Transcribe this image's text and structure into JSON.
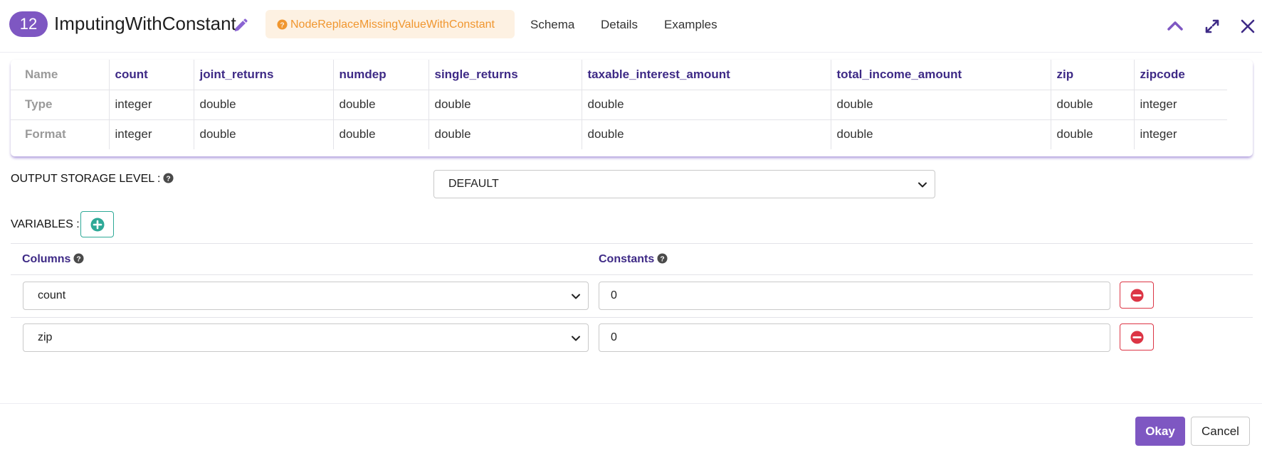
{
  "header": {
    "node_number": "12",
    "node_title": "ImputingWithConstant",
    "node_type": "NodeReplaceMissingValueWithConstant",
    "tabs": [
      "Schema",
      "Details",
      "Examples"
    ],
    "icons": [
      "pencil-icon",
      "question-circle-icon",
      "chevron-up-icon",
      "expand-icon",
      "close-icon"
    ],
    "accent_color": "#7e57c2",
    "chip_color": "#f0962f"
  },
  "schema": {
    "row_labels": [
      "Name",
      "Type",
      "Format"
    ],
    "columns": [
      {
        "name": "count",
        "type": "integer",
        "format": "integer"
      },
      {
        "name": "joint_returns",
        "type": "double",
        "format": "double"
      },
      {
        "name": "numdep",
        "type": "double",
        "format": "double"
      },
      {
        "name": "single_returns",
        "type": "double",
        "format": "double"
      },
      {
        "name": "taxable_interest_amount",
        "type": "double",
        "format": "double"
      },
      {
        "name": "total_income_amount",
        "type": "double",
        "format": "double"
      },
      {
        "name": "zip",
        "type": "double",
        "format": "double"
      },
      {
        "name": "zipcode",
        "type": "integer",
        "format": "integer"
      }
    ]
  },
  "storage": {
    "label": "OUTPUT STORAGE LEVEL :",
    "selected": "DEFAULT"
  },
  "variables": {
    "label": "VARIABLES :",
    "columns_header": "Columns",
    "constants_header": "Constants",
    "rows": [
      {
        "column": "count",
        "constant": "0"
      },
      {
        "column": "zip",
        "constant": "0"
      }
    ]
  },
  "footer": {
    "okay_label": "Okay",
    "cancel_label": "Cancel"
  }
}
